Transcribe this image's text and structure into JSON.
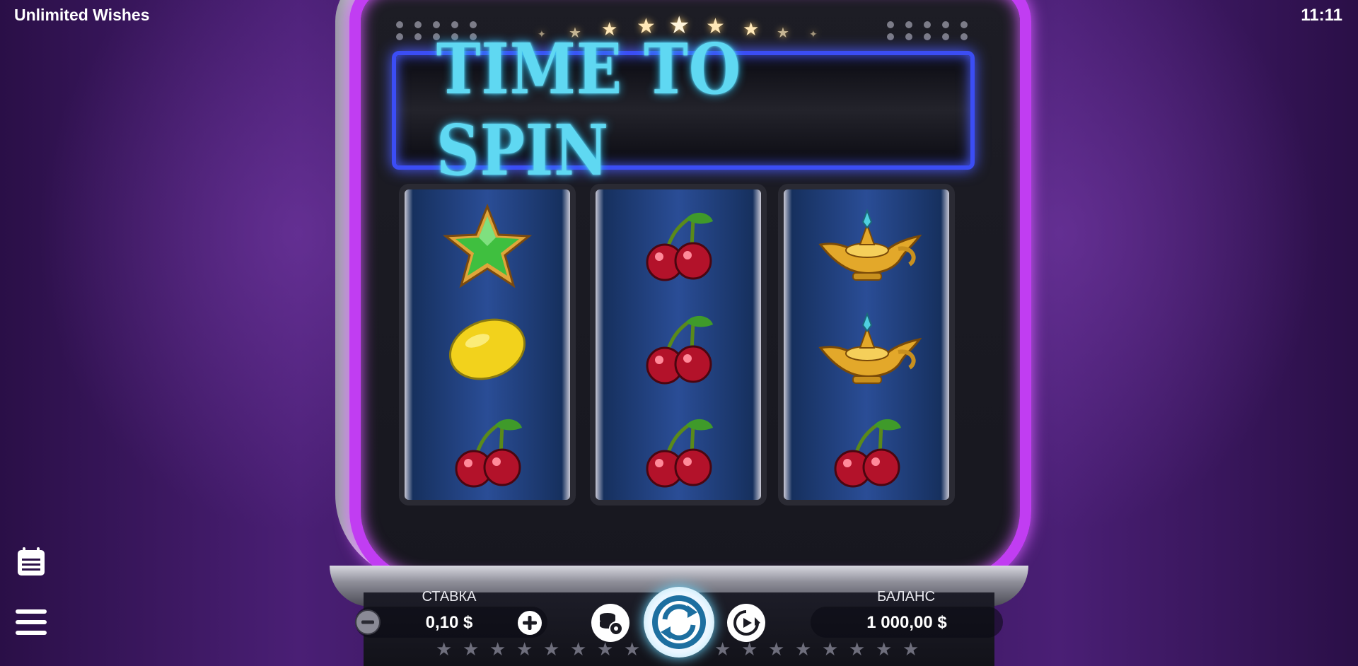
{
  "header": {
    "title": "Unlimited Wishes",
    "time": "11:11"
  },
  "machine": {
    "banner": "TIME TO SPIN"
  },
  "reels": [
    [
      "star",
      "lemon",
      "cherry"
    ],
    [
      "cherry",
      "cherry",
      "cherry"
    ],
    [
      "magic-lamp",
      "magic-lamp",
      "cherry"
    ]
  ],
  "controls": {
    "bet_label": "СТАВКА",
    "bet_value": "0,10 $",
    "balance_label": "БАЛАНС",
    "balance_value": "1 000,00 $"
  },
  "icons": {
    "menu": "menu-icon",
    "history": "history-icon",
    "bet_settings": "coins-settings-icon",
    "spin": "spin-icon",
    "autoplay": "autoplay-icon",
    "minus": "minus-icon",
    "plus": "plus-icon"
  },
  "colors": {
    "neon_frame": "#c13df2",
    "banner_text": "#5fd8f2",
    "banner_border": "#3b4df5",
    "background": "#2b0f48"
  }
}
